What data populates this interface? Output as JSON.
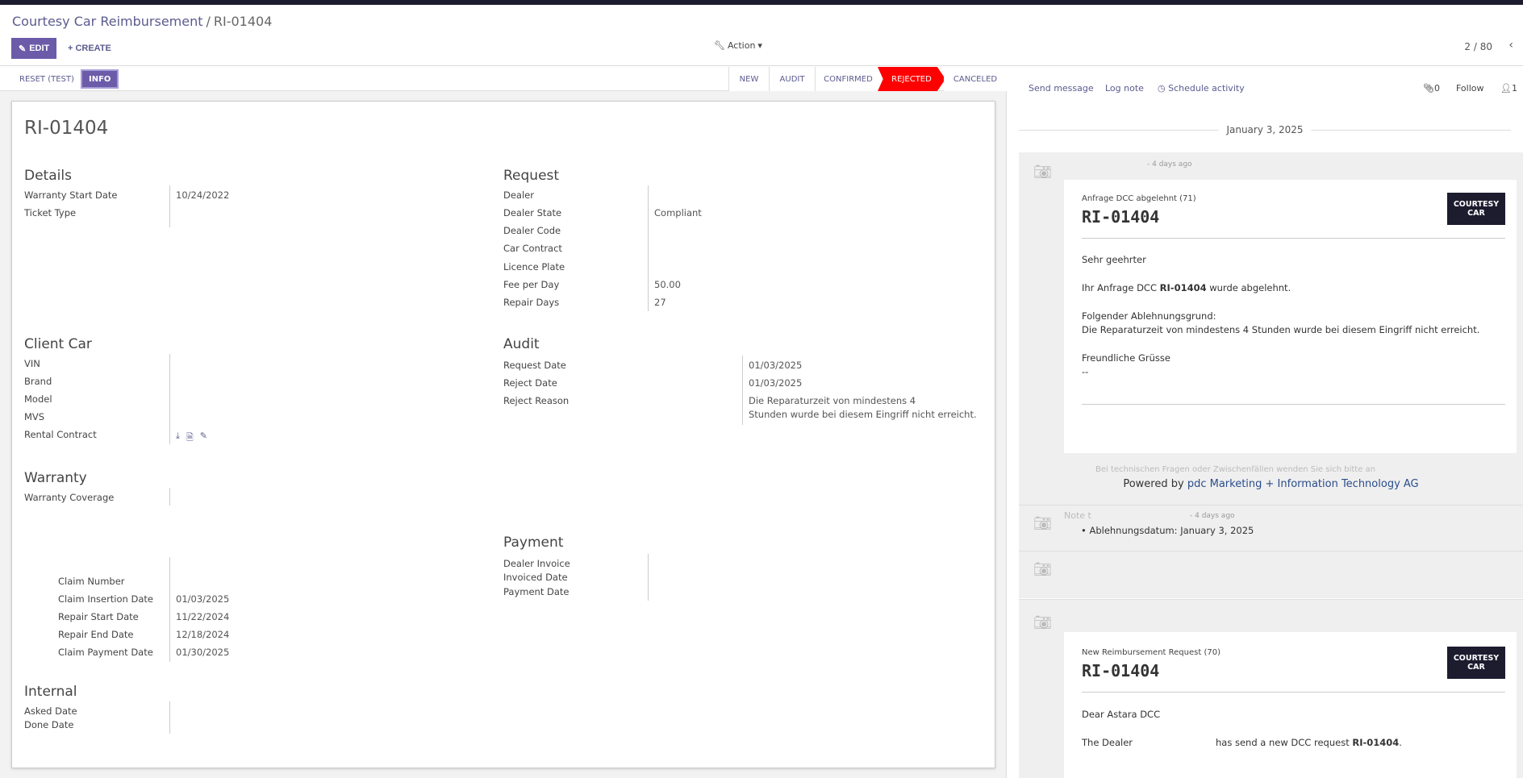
{
  "breadcrumb": {
    "parent": "Courtesy Car Reimbursement",
    "separator": "/",
    "current": "RI-01404"
  },
  "toolbar": {
    "edit": "EDIT",
    "create": "CREATE",
    "action": "Action",
    "pager": "2 / 80"
  },
  "statusbar": {
    "reset": "RESET (TEST)",
    "info": "INFO",
    "stages": [
      "NEW",
      "AUDIT",
      "CONFIRMED",
      "REJECTED",
      "CANCELED"
    ],
    "active_stage": "REJECTED"
  },
  "record": {
    "title": "RI-01404"
  },
  "details": {
    "heading": "Details",
    "warranty_start_label": "Warranty Start Date",
    "warranty_start": "10/24/2022",
    "ticket_type_label": "Ticket Type"
  },
  "request": {
    "heading": "Request",
    "dealer_label": "Dealer",
    "dealer_state_label": "Dealer State",
    "dealer_state": "Compliant",
    "dealer_code_label": "Dealer Code",
    "car_contract_label": "Car Contract",
    "licence_plate_label": "Licence Plate",
    "fee_label": "Fee per Day",
    "fee": "50.00",
    "repair_days_label": "Repair Days",
    "repair_days": "27"
  },
  "client_car": {
    "heading": "Client Car",
    "vin_label": "VIN",
    "brand_label": "Brand",
    "model_label": "Model",
    "mvs_label": "MVS",
    "rental_label": "Rental Contract"
  },
  "audit": {
    "heading": "Audit",
    "request_date_label": "Request Date",
    "request_date": "01/03/2025",
    "reject_date_label": "Reject Date",
    "reject_date": "01/03/2025",
    "reject_reason_label": "Reject Reason",
    "reject_reason_1": "Die Reparaturzeit von mindestens 4",
    "reject_reason_2": "Stunden wurde bei diesem Eingriff nicht erreicht."
  },
  "warranty": {
    "heading": "Warranty",
    "coverage_label": "Warranty Coverage",
    "claim_number_label": "Claim Number",
    "claim_insertion_label": "Claim Insertion Date",
    "claim_insertion": "01/03/2025",
    "repair_start_label": "Repair Start Date",
    "repair_start": "11/22/2024",
    "repair_end_label": "Repair End Date",
    "repair_end": "12/18/2024",
    "claim_payment_label": "Claim Payment Date",
    "claim_payment": "01/30/2025"
  },
  "payment": {
    "heading": "Payment",
    "dealer_invoice_label": "Dealer Invoice",
    "invoiced_date_label": "Invoiced Date",
    "payment_date_label": "Payment Date"
  },
  "internal": {
    "heading": "Internal",
    "asked_date_label": "Asked Date",
    "done_date_label": "Done Date"
  },
  "chatter": {
    "send_message": "Send message",
    "log_note": "Log note",
    "schedule_activity": "Schedule activity",
    "attachments": "0",
    "follow": "Follow",
    "followers": "1",
    "date_separator": "January 3, 2025",
    "msg1": {
      "time": "- 4 days ago",
      "subject": "Anfrage DCC abgelehnt (71)",
      "rid": "RI-01404",
      "badge_1": "COURTESY",
      "badge_2": "CAR",
      "greeting": "Sehr geehrter",
      "line1_pre": "Ihr Anfrage DCC ",
      "line1_rid": "RI-01404",
      "line1_post": " wurde abgelehnt.",
      "reason_head": "Folgender Ablehnungsgrund:",
      "reason": "Die Reparaturzeit von mindestens 4 Stunden wurde bei diesem Eingriff nicht erreicht.",
      "closing": "Freundliche Grüsse",
      "dash": "--",
      "footer_faded": "Bei technischen Fragen oder Zwischenfällen wenden Sie sich bitte an",
      "powered_by": "Powered by ",
      "company": "pdc Marketing + Information Technology AG"
    },
    "note": {
      "label": "Note t",
      "time": "- 4 days ago",
      "bullet": "Ablehnungsdatum: January 3, 2025"
    },
    "msg2": {
      "subject": "New Reimbursement Request (70)",
      "rid": "RI-01404",
      "badge_1": "COURTESY",
      "badge_2": "CAR",
      "greeting": "Dear Astara DCC",
      "line_a": "The Dealer",
      "line_b": "has send a new DCC request ",
      "line_b_rid": "RI-01404",
      "line_b_end": "."
    }
  }
}
